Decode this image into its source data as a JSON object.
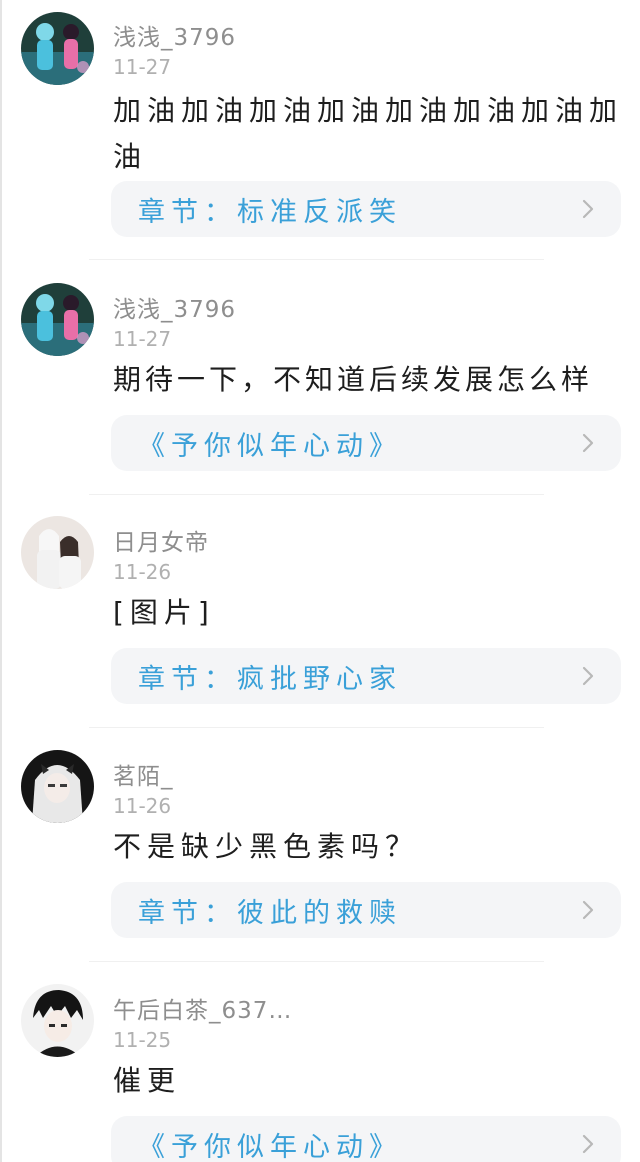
{
  "comments": [
    {
      "username": "浅浅_3796",
      "date": "11-27",
      "text": "加油加油加油加油加油加油加油加油",
      "chapter": "章节：标准反派笑",
      "avatar": "anime-duo-blue-pink-avatar"
    },
    {
      "username": "浅浅_3796",
      "date": "11-27",
      "text": "期待一下，不知道后续发展怎么样",
      "chapter": "《予你似年心动》",
      "avatar": "anime-duo-blue-pink-avatar"
    },
    {
      "username": "日月女帝",
      "date": "11-26",
      "text": "[图片]",
      "chapter": "章节：疯批野心家",
      "avatar": "couple-white-robes-avatar"
    },
    {
      "username": "茗陌_",
      "date": "11-26",
      "text": "不是缺少黑色素吗？",
      "chapter": "章节：彼此的救赎",
      "avatar": "white-haired-girl-avatar"
    },
    {
      "username": "午后白茶_637…",
      "date": "11-25",
      "text": "催更",
      "chapter": "《予你似年心动》",
      "avatar": "dark-haired-boy-avatar"
    }
  ],
  "colors": {
    "chapter_text": "#3aa0d8",
    "card_bg": "#f4f5f7",
    "username": "#8e8e8e",
    "date": "#b0b0b0"
  },
  "icons": {
    "chevron": "chevron-right-icon"
  }
}
